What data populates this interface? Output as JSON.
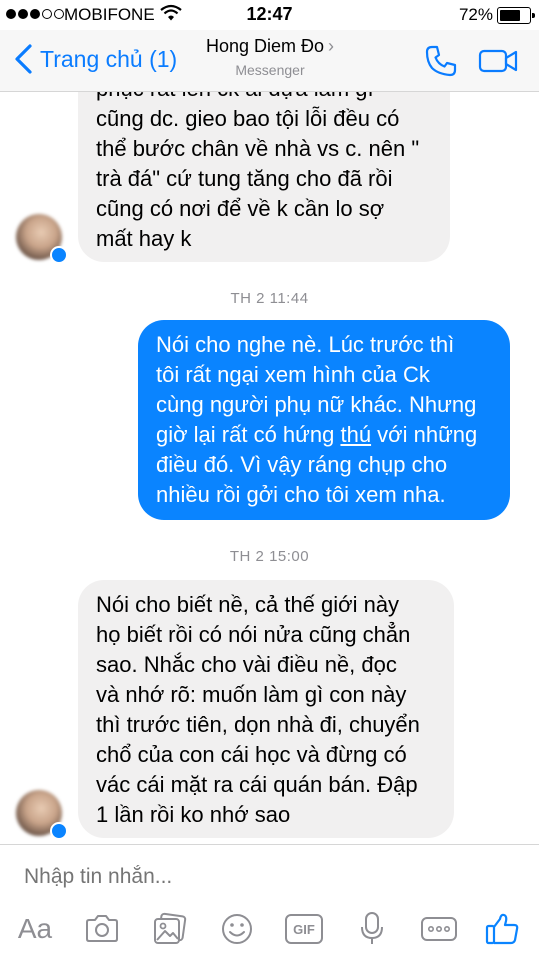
{
  "status_bar": {
    "carrier": "MOBIFONE",
    "time": "12:47",
    "battery_percent": "72%",
    "battery_level": 0.72
  },
  "header": {
    "back_label": "Trang chủ (1)",
    "contact_name": "Hong Diem Đo",
    "contact_subtitle": "Messenger"
  },
  "messages": [
    {
      "side": "incoming",
      "lines": [
        "phục rất lên ck ai dựa làm gì",
        "cũng dc. gieo bao tội lỗi đều có",
        "thể bước chân về nhà vs c. nên \"",
        "trà đá\" cứ tung tăng cho đã rồi",
        "cũng có nơi để về k cần lo sợ",
        "mất hay k"
      ]
    },
    {
      "timestamp": "TH 2 11:44"
    },
    {
      "side": "outgoing",
      "lines": [
        "Nói cho nghe nè. Lúc trước thì",
        "tôi rất ngại xem hình của Ck",
        "cùng người phụ nữ khác. Nhưng",
        "giờ lại rất có hứng thú với những",
        "điều đó. Vì vậy ráng chụp cho",
        "nhiều rồi gởi cho tôi xem nha."
      ]
    },
    {
      "timestamp": "TH 2 15:00"
    },
    {
      "side": "incoming",
      "lines": [
        "Nói cho biết nề, cả thế giới này",
        "họ biết rồi có nói nửa cũng chẳn",
        "sao. Nhắc cho vài điều nề, đọc",
        "và nhớ rõ: muốn làm gì con này",
        "thì trước tiên, dọn nhà đi, chuyển",
        "chổ của con cái học và đừng có",
        "vác cái mặt ra cái quán bán. Đập",
        "1 lần rồi ko nhớ sao"
      ]
    }
  ],
  "composer": {
    "placeholder": "Nhập tin nhắn...",
    "aa_label": "Aa",
    "gif_label": "GIF"
  },
  "colors": {
    "accent": "#0a84ff",
    "incoming_bubble": "#f1f0f0",
    "header_bg": "#f7f7f7"
  }
}
